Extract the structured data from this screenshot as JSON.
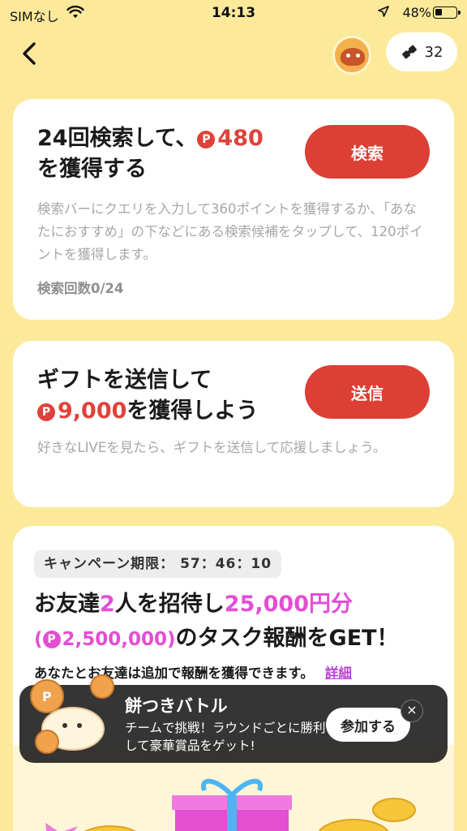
{
  "status_bar": {
    "carrier": "SIMなし",
    "time": "14:13",
    "battery": "48%"
  },
  "header": {
    "tickets": "32"
  },
  "search_task": {
    "title_line1": "24回検索して、",
    "points": "480",
    "title_line2": "を獲得する",
    "button": "検索",
    "description": "検索バーにクエリを入力して360ポイントを獲得するか、「あなたにおすすめ」の下などにある検索候補をタップして、120ポイントを獲得します。",
    "count": "検索回数0/24"
  },
  "gift_task": {
    "title_line1": "ギフトを送信して",
    "points": "9,000",
    "title_suffix": "を獲得しよう",
    "button": "送信",
    "description": "好きなLIVEを見たら、ギフトを送信して応援しましょう。"
  },
  "campaign": {
    "period": "キャンペーン期限： 57：46：10",
    "title_a": "お友達",
    "num": "2",
    "title_b": "人を招待し",
    "amount": "25,000円分",
    "points_open": "(",
    "points": "2,500,000)",
    "title_c": "のタスク報酬をGET！",
    "note": "あなたとお友達は追加で報酬を獲得できます。",
    "detail": "詳細"
  },
  "toast": {
    "title": "餅つきバトル",
    "body": "チームで挑戦！ラウンドごとに勝利して豪華賞品をゲット!",
    "join": "参加する",
    "close": "×"
  }
}
